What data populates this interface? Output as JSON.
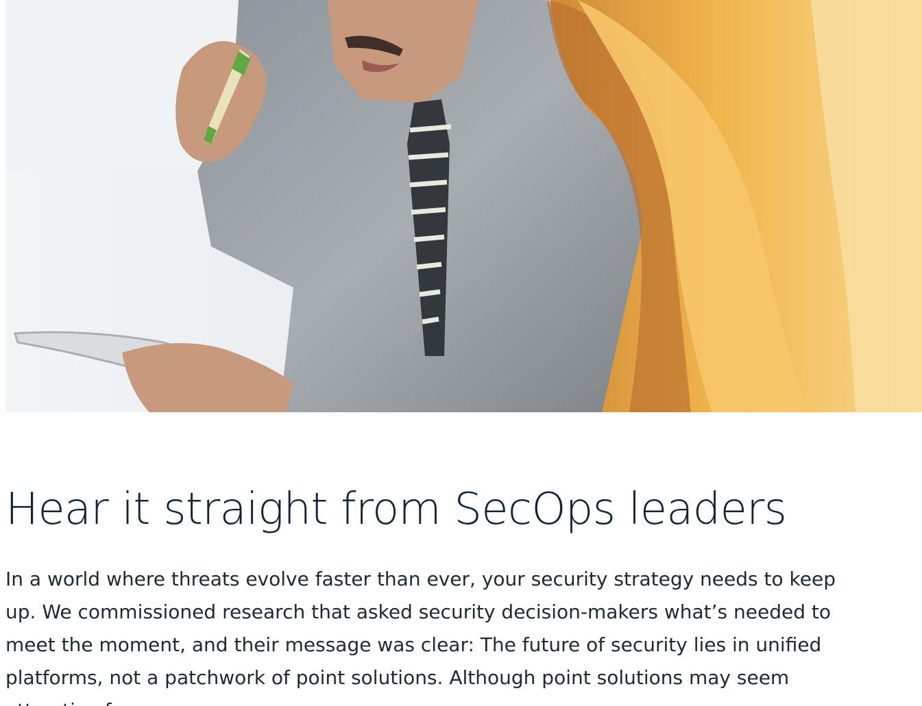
{
  "hero": {
    "image_alt": "Two people in a meeting; a man in a gray shirt and striped tie holds a tablet and pen while talking to a woman with long hair"
  },
  "section": {
    "heading": "Hear it straight from SecOps leaders",
    "body": "In a world where threats evolve faster than ever, your security strategy needs to keep up. We commissioned research that asked security decision-makers what’s needed to meet the moment, and their message was clear: The future of security lies in unified platforms, not a patchwork of point solutions. Although point solutions may seem attractive for"
  },
  "colors": {
    "heading_text": "#0f2436",
    "body_text": "#1d2a35",
    "hero_warm": "#f0b54c",
    "hero_cool": "#dfe5e9"
  }
}
